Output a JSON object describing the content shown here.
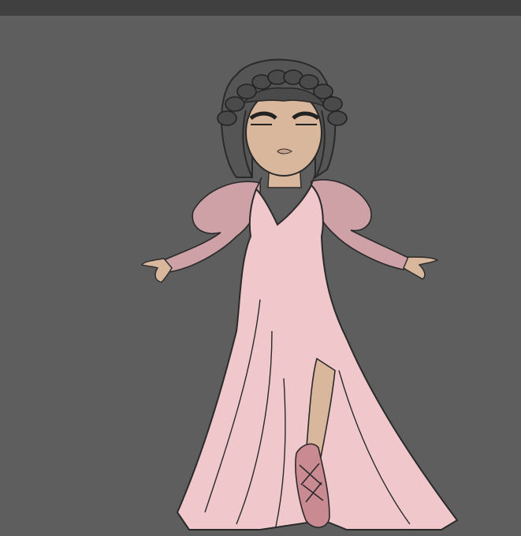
{
  "scene": {
    "description_label": "",
    "colors": {
      "background": "#5e5e5e",
      "topbar": "#404040",
      "dress": "#f0c8cb",
      "sleeve": "#d9a9ad",
      "skin": "#d9b79d",
      "hair": "#4a4a4a",
      "outline": "#2a2a2a",
      "shoe": "#c98a92"
    },
    "icons": [
      "character-illustration"
    ]
  }
}
